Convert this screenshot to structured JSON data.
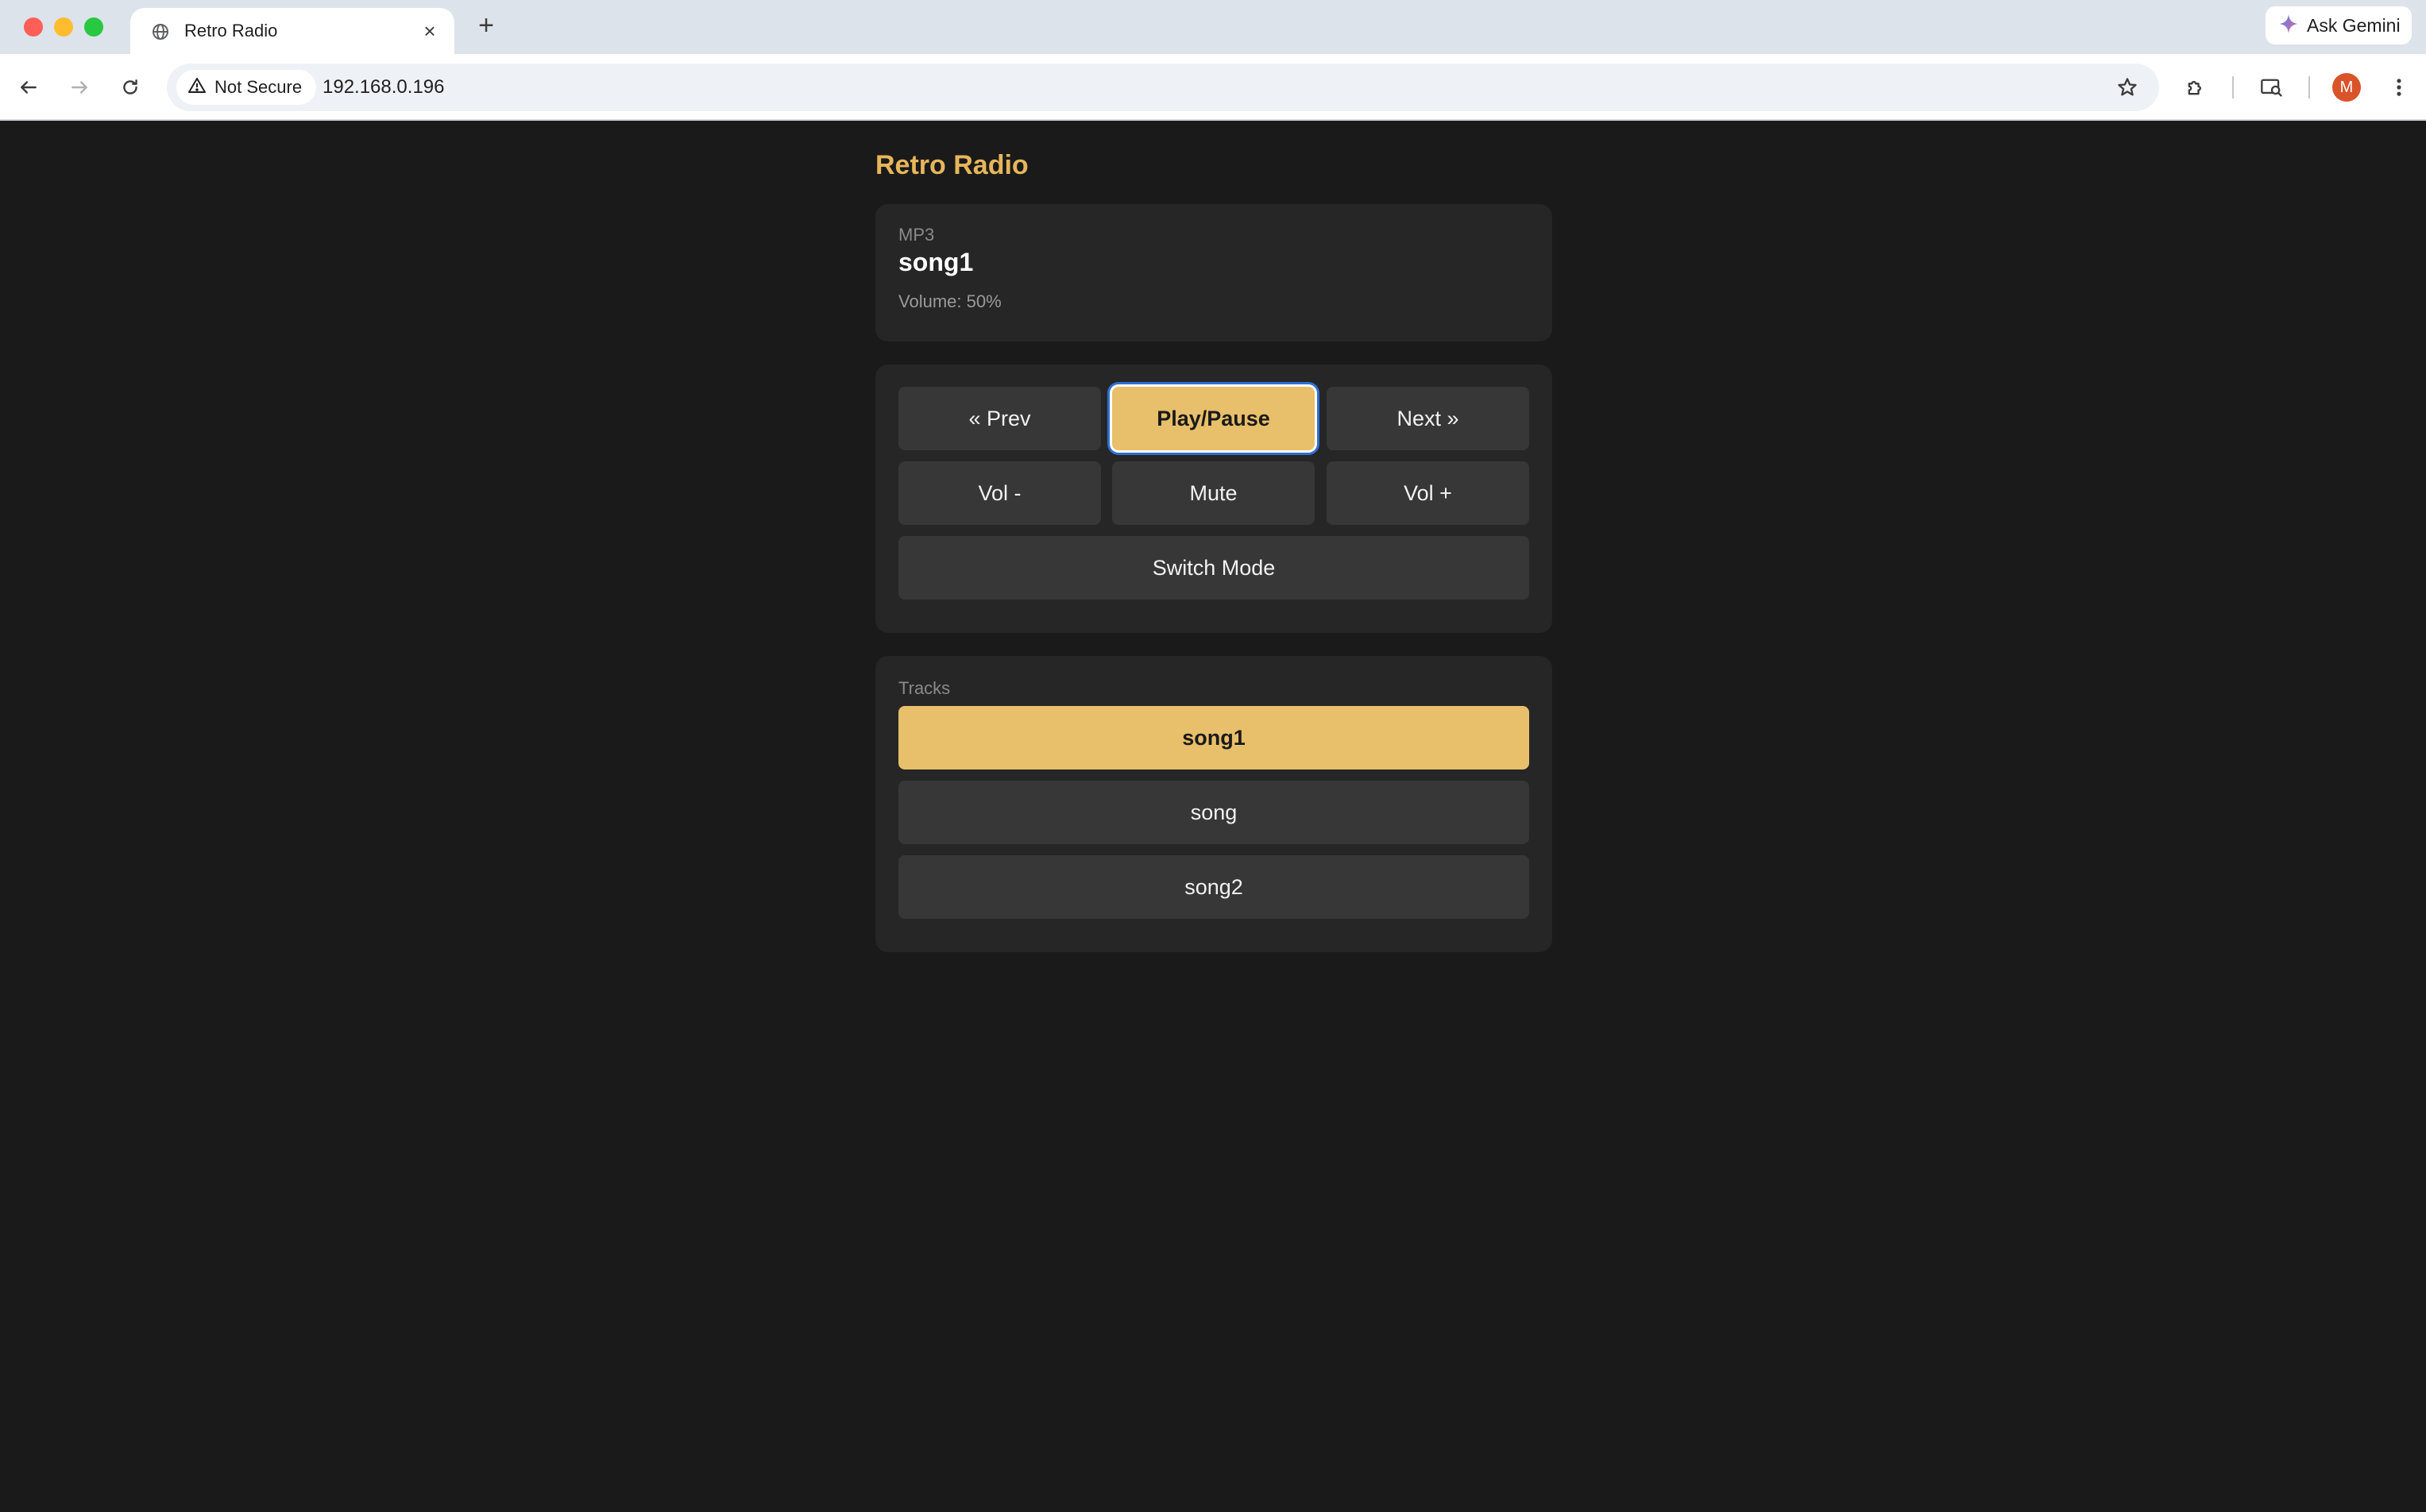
{
  "browser": {
    "tab_title": "Retro Radio",
    "new_tab_symbol": "+",
    "close_symbol": "×",
    "gemini_label": "Ask Gemini",
    "security_label": "Not Secure",
    "url": "192.168.0.196",
    "avatar_letter": "M"
  },
  "page": {
    "title": "Retro Radio"
  },
  "now_playing": {
    "mode": "MP3",
    "track": "song1",
    "volume_text": "Volume: 50%"
  },
  "controls": {
    "prev": "« Prev",
    "play_pause": "Play/Pause",
    "next": "Next »",
    "vol_down": "Vol -",
    "mute": "Mute",
    "vol_up": "Vol +",
    "switch_mode": "Switch Mode"
  },
  "tracks": {
    "label": "Tracks",
    "items": [
      {
        "name": "song1",
        "active": true
      },
      {
        "name": "song",
        "active": false
      },
      {
        "name": "song2",
        "active": false
      }
    ]
  },
  "colors": {
    "accent": "#e8bf6a",
    "title": "#e6b65a",
    "background": "#1a1a1a",
    "card": "#262626",
    "button": "#373737",
    "focus_ring": "#2f6fd0"
  }
}
